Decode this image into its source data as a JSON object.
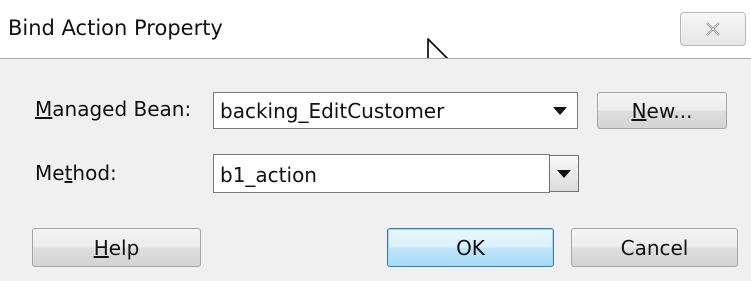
{
  "dialog": {
    "title": "Bind Action Property"
  },
  "managed_bean": {
    "label_pre": "",
    "label_mnemonic": "M",
    "label_post": "anaged Bean:",
    "value": "backing_EditCustomer",
    "new_pre": "",
    "new_mnemonic": "N",
    "new_post": "ew..."
  },
  "method": {
    "label_pre": "Me",
    "label_mnemonic": "t",
    "label_post": "hod:",
    "value": "b1_action"
  },
  "buttons": {
    "help_pre": "",
    "help_mnemonic": "H",
    "help_post": "elp",
    "ok": "OK",
    "cancel": "Cancel"
  },
  "icons": {
    "close": "close-icon",
    "cursor": "mouse-pointer-icon",
    "dropdown": "chevron-down-icon"
  },
  "colors": {
    "panel": "#f0f0f0",
    "default_button": "#bee6fd",
    "default_button_border": "#3c7fb1"
  }
}
